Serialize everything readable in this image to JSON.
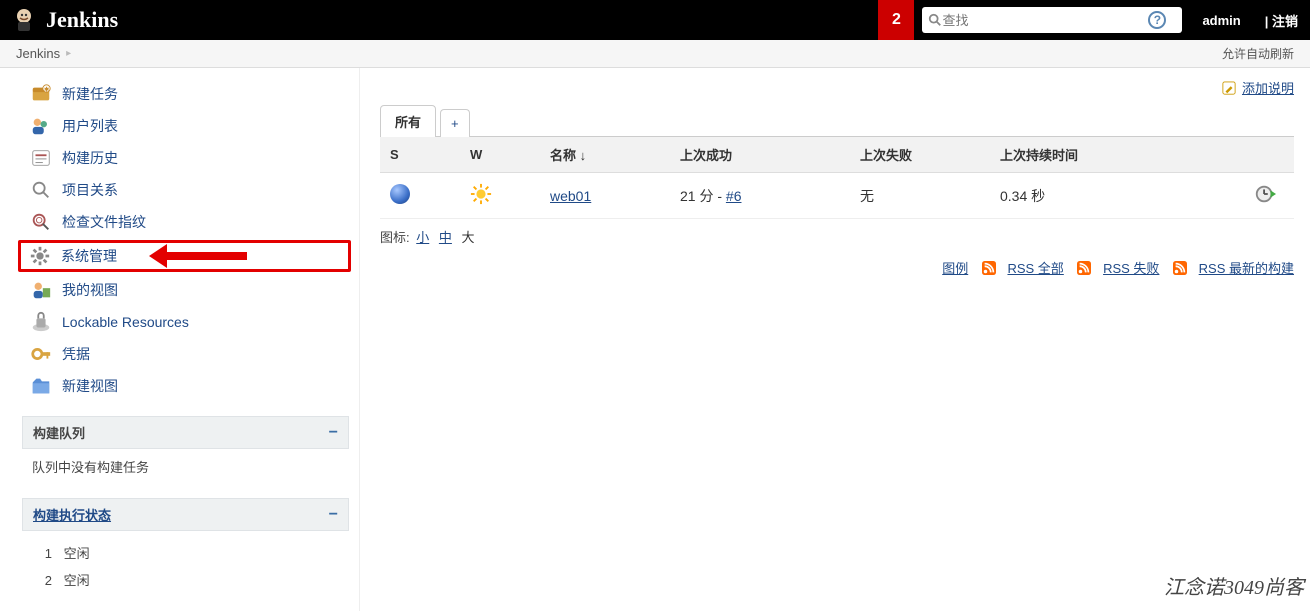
{
  "header": {
    "brand": "Jenkins",
    "notifications": "2",
    "search_placeholder": "查找",
    "help": "?",
    "user": "admin",
    "logout": "| 注销"
  },
  "breadcrumb": {
    "root": "Jenkins",
    "auto_refresh": "允许自动刷新"
  },
  "sidebar": {
    "items": [
      {
        "label": "新建任务",
        "icon": "new"
      },
      {
        "label": "用户列表",
        "icon": "people"
      },
      {
        "label": "构建历史",
        "icon": "history"
      },
      {
        "label": "项目关系",
        "icon": "search"
      },
      {
        "label": "检查文件指纹",
        "icon": "fingerprint"
      },
      {
        "label": "系统管理",
        "icon": "gear",
        "highlight": true
      },
      {
        "label": "我的视图",
        "icon": "myview"
      },
      {
        "label": "Lockable Resources",
        "icon": "lock"
      },
      {
        "label": "凭据",
        "icon": "key"
      },
      {
        "label": "新建视图",
        "icon": "folder"
      }
    ]
  },
  "panes": {
    "queue": {
      "title": "构建队列",
      "empty_text": "队列中没有构建任务"
    },
    "executors": {
      "title": "构建执行状态",
      "rows": [
        {
          "num": "1",
          "state": "空闲"
        },
        {
          "num": "2",
          "state": "空闲"
        }
      ]
    }
  },
  "main": {
    "add_description": "添加说明",
    "tabs": {
      "all": "所有",
      "plus": "+"
    },
    "columns": {
      "s": "S",
      "w": "W",
      "name": "名称 ↓",
      "last_success": "上次成功",
      "last_failure": "上次失败",
      "duration": "上次持续时间"
    },
    "row": {
      "name": "web01",
      "last_success_prefix": "21 分 - ",
      "last_success_build": "#6",
      "last_failure": "无",
      "duration": "0.34 秒"
    },
    "icon_legend_label": "图标:",
    "icon_sizes": {
      "s": "小",
      "m": "中",
      "l": "大"
    },
    "footer": {
      "legend": "图例",
      "rss_all": "RSS 全部",
      "rss_fail": "RSS 失败",
      "rss_latest": "RSS 最新的构建"
    }
  },
  "watermark": "江念诺3049尚客"
}
